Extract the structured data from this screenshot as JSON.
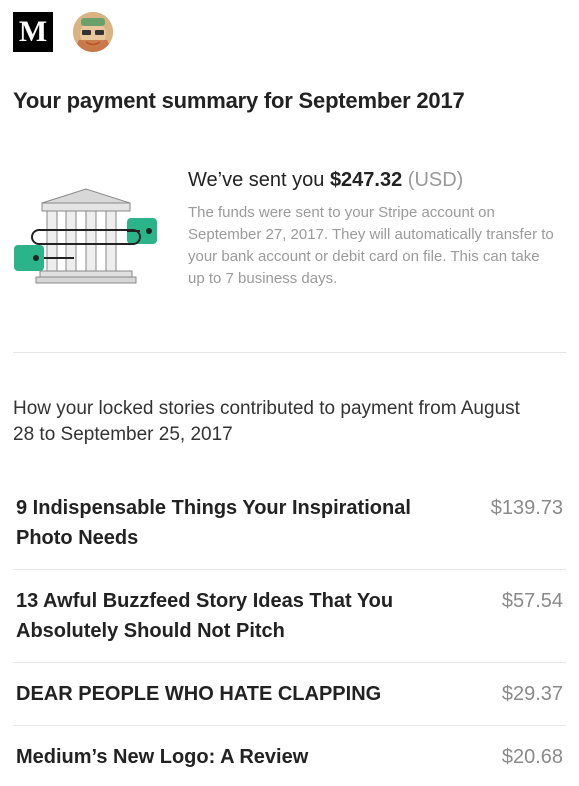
{
  "header": {
    "logo_letter": "M",
    "logo_icon": "medium-logo-icon",
    "avatar_icon": "user-avatar"
  },
  "summary": {
    "title": "Your payment summary for September 2017",
    "sent_prefix": "We’ve sent you ",
    "sent_amount": "$247.32",
    "sent_currency": " (USD)",
    "description": "The funds were sent to your Stripe account on September 27, 2017. They will automatically transfer to your bank account or debit card on file. This can take up to 7 business days.",
    "illustration_icon": "bank-building-icon"
  },
  "contributions": {
    "heading": "How your locked stories contributed to payment from August 28 to September 25, 2017",
    "stories": [
      {
        "title": "9 Indispensable Things Your Inspirational Photo Needs",
        "amount": "$139.73"
      },
      {
        "title": "13 Awful Buzzfeed Story Ideas That You Absolutely Should Not Pitch",
        "amount": "$57.54"
      },
      {
        "title": "DEAR PEOPLE WHO HATE CLAPPING",
        "amount": "$29.37"
      },
      {
        "title": "Medium’s New Logo: A Review",
        "amount": "$20.68"
      }
    ]
  },
  "colors": {
    "accent_green": "#2bb38a",
    "muted_text": "#9a9a9a"
  }
}
